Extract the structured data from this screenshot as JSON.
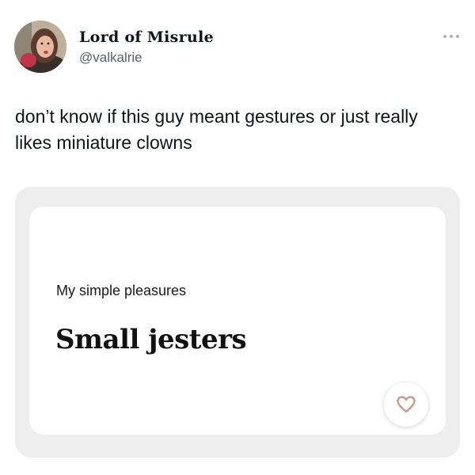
{
  "author": {
    "display_name": "Lord of Misrule",
    "handle": "@valkalrie",
    "avatar_icon": "profile-photo"
  },
  "menu": {
    "icon": "more-horizontal-icon"
  },
  "tweet": {
    "text": "don’t know if this guy meant gestures or just really likes miniature clowns"
  },
  "media": {
    "prompt_label": "My simple pleasures",
    "prompt_answer": "Small jesters",
    "like_icon": "heart-icon",
    "colors": {
      "background": "#eeeeee",
      "card": "#ffffff",
      "heart": "#c9a091"
    }
  }
}
